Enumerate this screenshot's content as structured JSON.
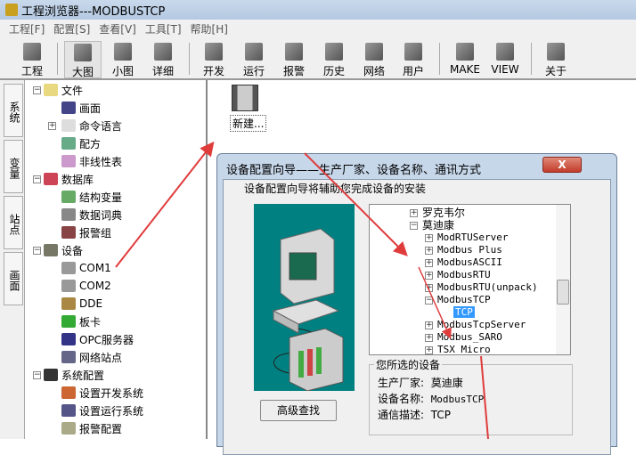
{
  "window": {
    "title": "工程浏览器---MODBUSTCP"
  },
  "menu": [
    "工程[F]",
    "配置[S]",
    "查看[V]",
    "工具[T]",
    "帮助[H]"
  ],
  "toolbar": [
    "工程",
    "大图",
    "小图",
    "详细",
    "开发",
    "运行",
    "报警",
    "历史",
    "网络",
    "用户",
    "MAKE",
    "VIEW",
    "关于"
  ],
  "vtabs": [
    "系统",
    "变量",
    "站点",
    "画面"
  ],
  "tree": [
    {
      "label": "文件",
      "level": 0,
      "exp": "-"
    },
    {
      "label": "画面",
      "level": 1
    },
    {
      "label": "命令语言",
      "level": 1,
      "exp": "+"
    },
    {
      "label": "配方",
      "level": 1
    },
    {
      "label": "非线性表",
      "level": 1
    },
    {
      "label": "数据库",
      "level": 0,
      "exp": "-"
    },
    {
      "label": "结构变量",
      "level": 1
    },
    {
      "label": "数据词典",
      "level": 1
    },
    {
      "label": "报警组",
      "level": 1
    },
    {
      "label": "设备",
      "level": 0,
      "exp": "-"
    },
    {
      "label": "COM1",
      "level": 1
    },
    {
      "label": "COM2",
      "level": 1
    },
    {
      "label": "DDE",
      "level": 1
    },
    {
      "label": "板卡",
      "level": 1
    },
    {
      "label": "OPC服务器",
      "level": 1
    },
    {
      "label": "网络站点",
      "level": 1
    },
    {
      "label": "系统配置",
      "level": 0,
      "exp": "-"
    },
    {
      "label": "设置开发系统",
      "level": 1
    },
    {
      "label": "设置运行系统",
      "level": 1
    },
    {
      "label": "报警配置",
      "level": 1
    }
  ],
  "workspace": {
    "new_label": "新建..."
  },
  "dialog": {
    "title": "设备配置向导——生产厂家、设备名称、通讯方式",
    "close": "X",
    "subtitle": "设备配置向导将辅助您完成设备的安装",
    "device_tree": [
      {
        "label": "罗克韦尔",
        "level": 0,
        "exp": "+"
      },
      {
        "label": "莫迪康",
        "level": 0,
        "exp": "-"
      },
      {
        "label": "ModRTUServer",
        "level": 1,
        "exp": "+"
      },
      {
        "label": "Modbus Plus",
        "level": 1,
        "exp": "+"
      },
      {
        "label": "ModbusASCII",
        "level": 1,
        "exp": "+"
      },
      {
        "label": "ModbusRTU",
        "level": 1,
        "exp": "+"
      },
      {
        "label": "ModbusRTU(unpack)",
        "level": 1,
        "exp": "+"
      },
      {
        "label": "ModbusTCP",
        "level": 1,
        "exp": "-"
      },
      {
        "label": "TCP",
        "level": 2,
        "selected": true
      },
      {
        "label": "ModbusTcpServer",
        "level": 1,
        "exp": "+"
      },
      {
        "label": "Modbus_SARO",
        "level": 1,
        "exp": "+"
      },
      {
        "label": "TSX Micro",
        "level": 1,
        "exp": "+"
      }
    ],
    "selected_group": {
      "title": "您所选的设备",
      "manufacturer_label": "生产厂家:",
      "manufacturer": "莫迪康",
      "name_label": "设备名称:",
      "name": "ModbusTCP",
      "comm_label": "通信描述:",
      "comm": "TCP"
    },
    "advanced_button": "高级查找"
  },
  "colors": {
    "annotation_arrow": "#e03c3c",
    "selection": "#3399ff",
    "teal": "#008080"
  }
}
